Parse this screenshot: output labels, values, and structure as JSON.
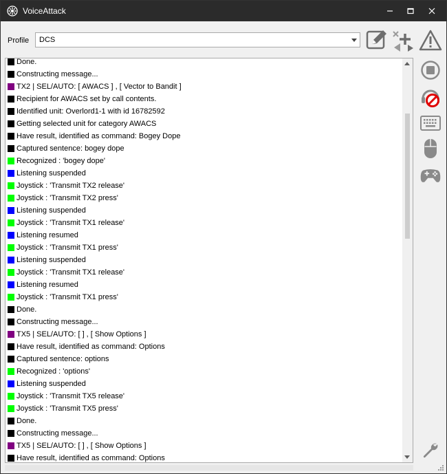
{
  "window": {
    "title": "VoiceAttack",
    "icons": {
      "app": "voiceattack-logo-icon",
      "minimize": "minimize-icon",
      "maximize": "maximize-icon",
      "close": "close-icon"
    }
  },
  "profile": {
    "label": "Profile",
    "selected": "DCS"
  },
  "toolbar": {
    "icons": [
      "edit-profile-icon",
      "add-profile-icon",
      "warning-icon"
    ]
  },
  "sidebar": {
    "icons": [
      "stop-icon",
      "listening-off-icon",
      "keyboard-icon",
      "mouse-icon",
      "joystick-icon",
      "wrench-icon"
    ]
  },
  "colors": {
    "black": "#000000",
    "purple": "#800080",
    "green": "#00ff00",
    "blue": "#0000ff",
    "titlebar": "#2b2b2b",
    "icon_gray": "#8a8a8a",
    "icon_red": "#e00000"
  },
  "log": [
    {
      "color": "#000000",
      "text": "Done."
    },
    {
      "color": "#000000",
      "text": "Constructing message..."
    },
    {
      "color": "#800080",
      "text": "TX2 | SEL/AUTO: [ AWACS ] ,  [ Vector to Bandit ]"
    },
    {
      "color": "#000000",
      "text": "Recipient for AWACS set by call contents."
    },
    {
      "color": "#000000",
      "text": "Identified unit: Overlord1-1 with id 16782592"
    },
    {
      "color": "#000000",
      "text": "Getting selected unit for category AWACS"
    },
    {
      "color": "#000000",
      "text": "Have result, identified as command: Bogey Dope"
    },
    {
      "color": "#000000",
      "text": "Captured sentence: bogey dope"
    },
    {
      "color": "#00ff00",
      "text": "Recognized : 'bogey dope'"
    },
    {
      "color": "#0000ff",
      "text": "Listening suspended"
    },
    {
      "color": "#00ff00",
      "text": "Joystick : 'Transmit TX2 release'"
    },
    {
      "color": "#00ff00",
      "text": "Joystick : 'Transmit TX2 press'"
    },
    {
      "color": "#0000ff",
      "text": "Listening suspended"
    },
    {
      "color": "#00ff00",
      "text": "Joystick : 'Transmit TX1 release'"
    },
    {
      "color": "#0000ff",
      "text": "Listening resumed"
    },
    {
      "color": "#00ff00",
      "text": "Joystick : 'Transmit TX1 press'"
    },
    {
      "color": "#0000ff",
      "text": "Listening suspended"
    },
    {
      "color": "#00ff00",
      "text": "Joystick : 'Transmit TX1 release'"
    },
    {
      "color": "#0000ff",
      "text": "Listening resumed"
    },
    {
      "color": "#00ff00",
      "text": "Joystick : 'Transmit TX1 press'"
    },
    {
      "color": "#000000",
      "text": "Done."
    },
    {
      "color": "#000000",
      "text": "Constructing message..."
    },
    {
      "color": "#800080",
      "text": "TX5 | SEL/AUTO: [   ] ,  [ Show Options ]"
    },
    {
      "color": "#000000",
      "text": "Have result, identified as command: Options"
    },
    {
      "color": "#000000",
      "text": "Captured sentence: options"
    },
    {
      "color": "#00ff00",
      "text": "Recognized : 'options'"
    },
    {
      "color": "#0000ff",
      "text": "Listening suspended"
    },
    {
      "color": "#00ff00",
      "text": "Joystick : 'Transmit TX5 release'"
    },
    {
      "color": "#00ff00",
      "text": "Joystick : 'Transmit TX5 press'"
    },
    {
      "color": "#000000",
      "text": "Done."
    },
    {
      "color": "#000000",
      "text": "Constructing message..."
    },
    {
      "color": "#800080",
      "text": "TX5 | SEL/AUTO: [   ] ,  [ Show Options ]"
    },
    {
      "color": "#000000",
      "text": "Have result, identified as command: Options"
    }
  ]
}
